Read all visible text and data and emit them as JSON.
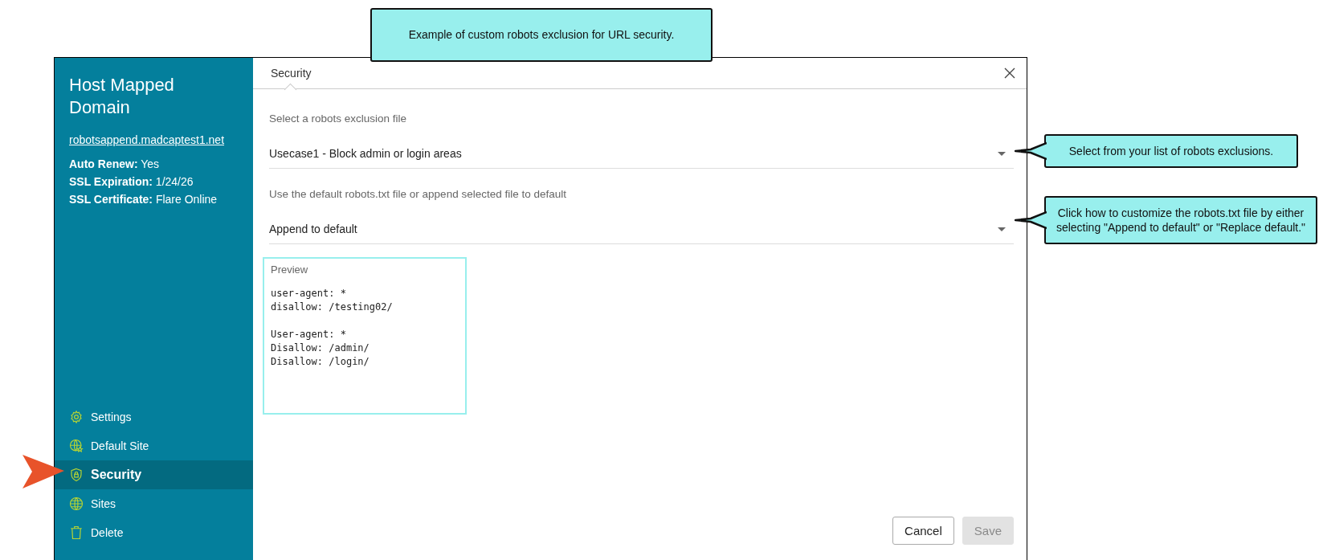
{
  "callouts": [
    {
      "text": "Example of custom robots exclusion for URL security.",
      "kind": "top"
    },
    {
      "text": "Select from your list of robots exclusions.",
      "kind": "left"
    },
    {
      "text": "Click how to customize the robots.txt file by either selecting \"Append to default\" or \"Replace default.\"",
      "kind": "left"
    }
  ],
  "sidebar": {
    "title": "Host Mapped Domain",
    "link": "robotsappend.madcaptest1.net",
    "info": [
      {
        "label": "Auto Renew:",
        "value": "Yes"
      },
      {
        "label": "SSL Expiration:",
        "value": "1/24/26"
      },
      {
        "label": "SSL Certificate:",
        "value": "Flare Online"
      }
    ],
    "items": [
      {
        "label": "Settings",
        "selected": false
      },
      {
        "label": "Default Site",
        "selected": false
      },
      {
        "label": "Security",
        "selected": true
      },
      {
        "label": "Sites",
        "selected": false
      },
      {
        "label": "Delete",
        "selected": false
      }
    ]
  },
  "tabs": [
    {
      "label": "Security",
      "selected": true
    }
  ],
  "fields": [
    {
      "label": "Select a robots exclusion file",
      "value": "Usecase1 - Block admin or login areas"
    },
    {
      "label": "Use the default robots.txt file or append selected file to default",
      "value": "Append to default"
    }
  ],
  "preview": {
    "label": "Preview",
    "text": "user-agent: *\ndisallow: /testing02/\n\nUser-agent: *\nDisallow: /admin/\nDisallow: /login/"
  },
  "buttons": [
    {
      "label": "Cancel",
      "disabled": false
    },
    {
      "label": "Save",
      "disabled": true
    }
  ]
}
